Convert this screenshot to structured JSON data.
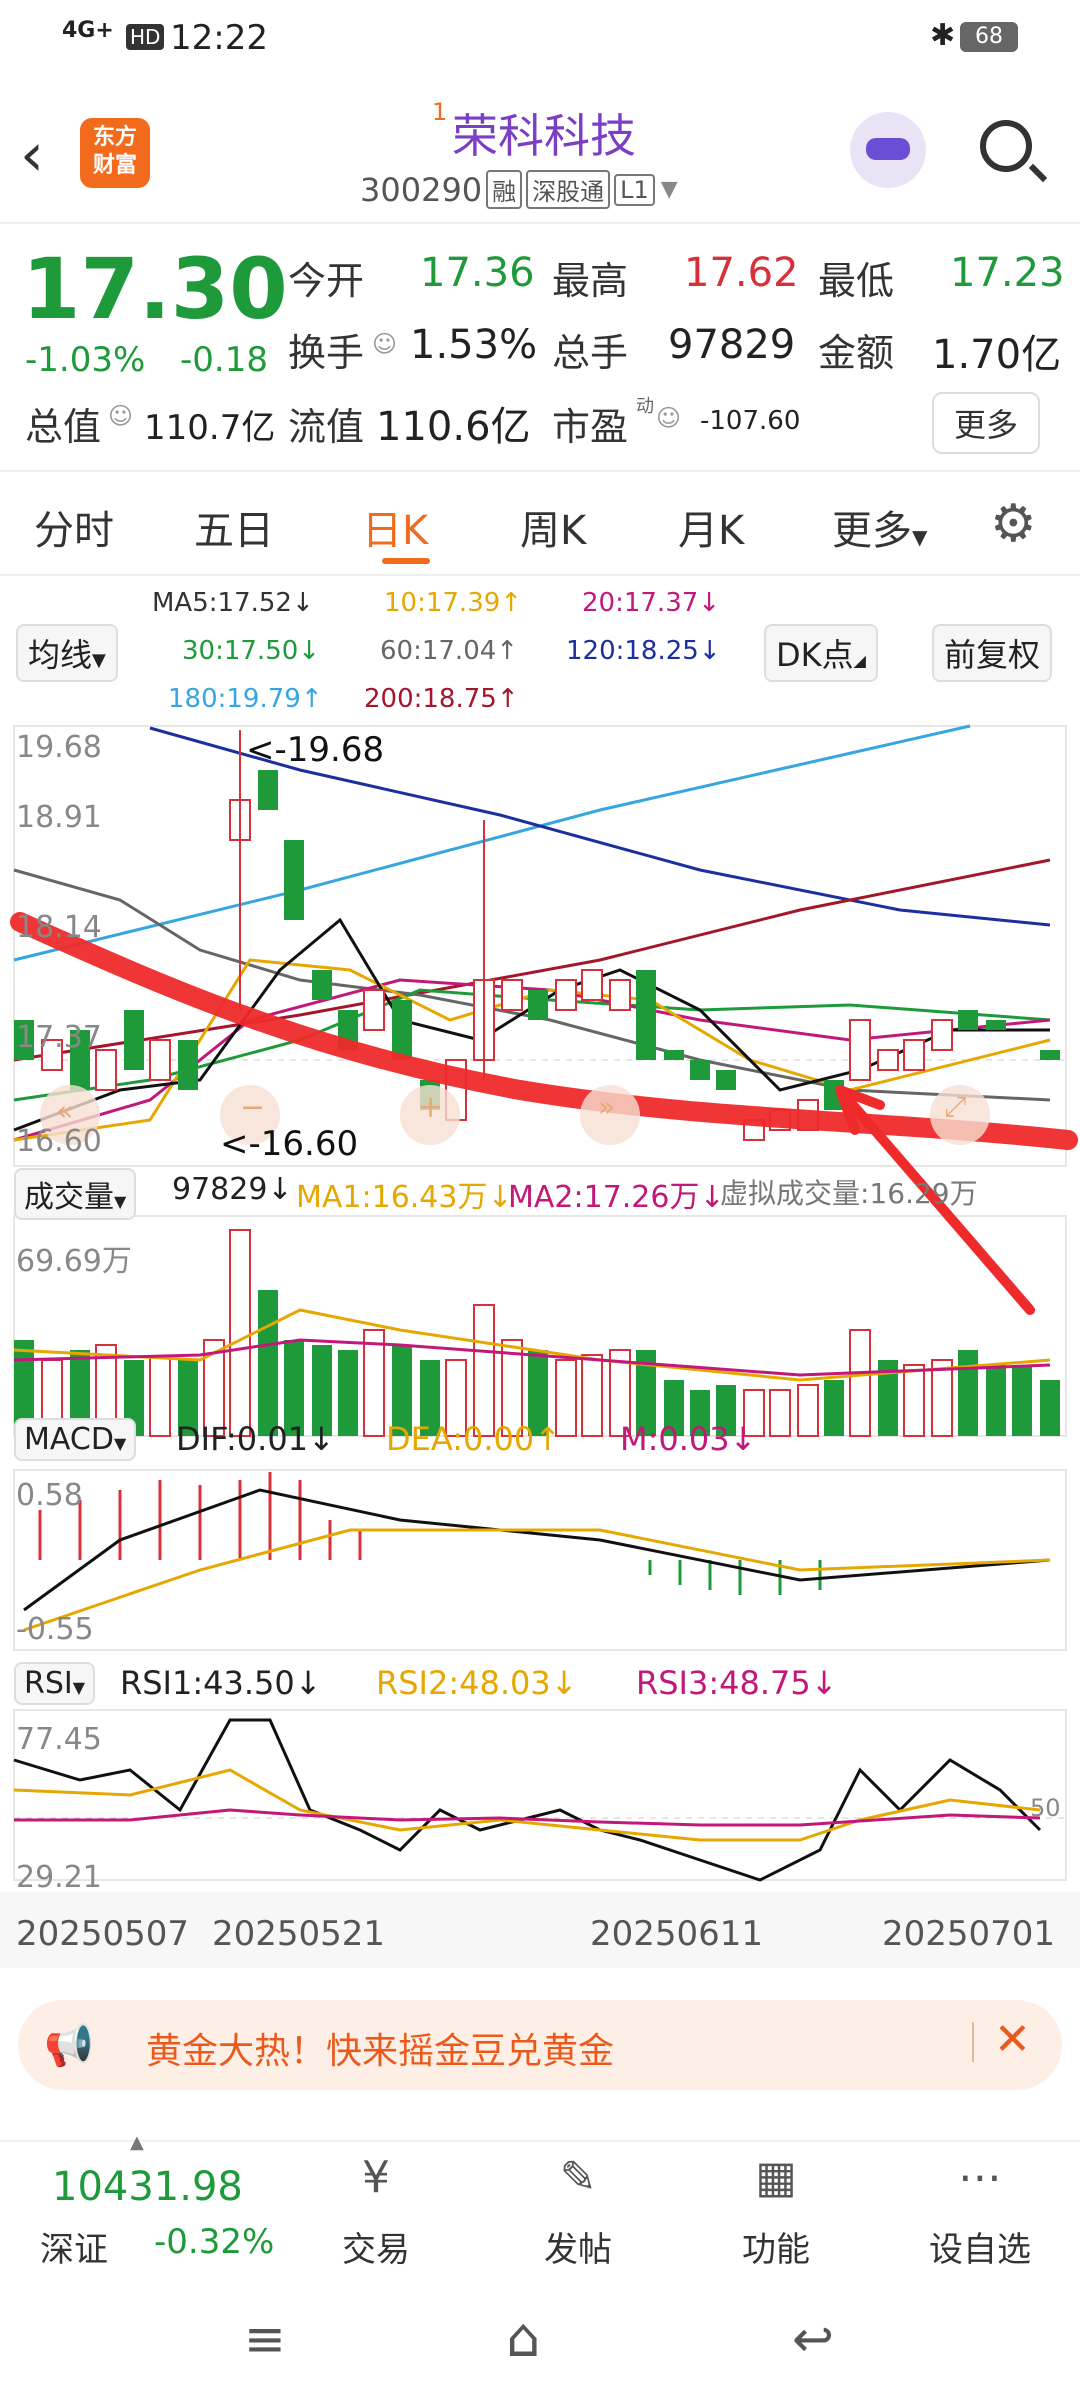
{
  "status": {
    "network": "4G+",
    "hd": "HD",
    "time": "12:22",
    "battery": "68"
  },
  "header": {
    "logo_line1": "东方",
    "logo_line2": "财富",
    "superscript": "1",
    "name": "荣科科技",
    "code": "300290",
    "tag_rong": "融",
    "tag_sgt": "深股通",
    "tag_l1": "L1"
  },
  "quote": {
    "price": "17.30",
    "pct": "-1.03%",
    "chg": "-0.18",
    "open_label": "今开",
    "open": "17.36",
    "high_label": "最高",
    "high": "17.62",
    "low_label": "最低",
    "low": "17.23",
    "turnover_label": "换手",
    "turnover": "1.53%",
    "volume_label": "总手",
    "volume": "97829",
    "amount_label": "金额",
    "amount": "1.70亿",
    "mcap_label": "总值",
    "mcap": "110.7亿",
    "float_label": "流值",
    "float": "110.6亿",
    "pe_label": "市盈",
    "pe_sup": "动",
    "pe": "-107.60",
    "more_button": "更多"
  },
  "tabs": {
    "t1": "分时",
    "t2": "五日",
    "t3": "日K",
    "t4": "周K",
    "t5": "月K",
    "t6": "更多"
  },
  "ma": {
    "selector": "均线",
    "ma5": "MA5:17.52↓",
    "ma10": "10:17.39↑",
    "ma20": "20:17.37↓",
    "ma30": "30:17.50↓",
    "ma60": "60:17.04↑",
    "ma120": "120:18.25↓",
    "ma180": "180:19.79↑",
    "ma200": "200:18.75↑",
    "dk": "DK点",
    "fq": "前复权"
  },
  "kline": {
    "y1": "19.68",
    "y2": "18.91",
    "y3": "18.14",
    "y4": "17.37",
    "y5": "16.60",
    "max_marker": "<-19.68",
    "min_marker": "<-16.60"
  },
  "vol": {
    "selector": "成交量",
    "val": "97829↓",
    "ma1": "MA1:16.43万↓",
    "ma2": "MA2:17.26万↓",
    "virtual": "虚拟成交量:16.29万",
    "ymax": "69.69万"
  },
  "macd": {
    "selector": "MACD",
    "dif": "DIF:0.01↓",
    "dea": "DEA:0.00↑",
    "m": "M:0.03↓",
    "ymax": "0.58",
    "ymin": "-0.55"
  },
  "rsi": {
    "selector": "RSI",
    "r1": "RSI1:43.50↓",
    "r2": "RSI2:48.03↓",
    "r3": "RSI3:48.75↓",
    "ymax": "77.45",
    "ymid": "50",
    "ymin": "29.21"
  },
  "dates": {
    "d1": "20250507",
    "d2": "20250521",
    "d3": "20250611",
    "d4": "20250701"
  },
  "banner": {
    "text": "黄金大热！快来摇金豆兑黄金"
  },
  "bottom": {
    "index_value": "10431.98",
    "index_name": "深证",
    "index_pct": "-0.32%",
    "trade": "交易",
    "post": "发帖",
    "func": "功能",
    "watch": "设自选"
  },
  "colors": {
    "up": "#d6303a",
    "down": "#1f9a3a",
    "accent": "#f26b1d",
    "annotation": "#ee2a2a"
  }
}
